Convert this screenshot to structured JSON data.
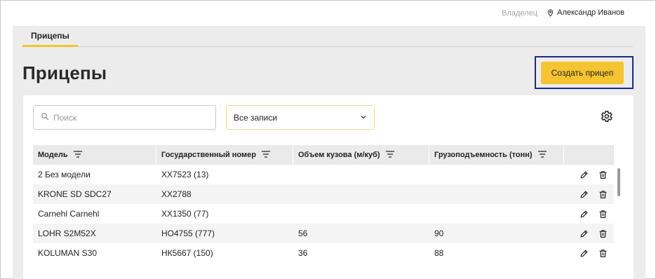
{
  "header": {
    "role_label": "Владелец",
    "user_name": "Александр Иванов"
  },
  "tabs": [
    {
      "label": "Прицепы",
      "active": true
    }
  ],
  "page": {
    "title": "Прицепы",
    "create_button": "Создать прицеп"
  },
  "filters": {
    "search_placeholder": "Поиск",
    "records_select": "Все записи"
  },
  "table": {
    "columns": [
      "Модель",
      "Государственный номер",
      "Объем кузова (м/куб)",
      "Грузоподъемность (тонн)"
    ],
    "rows": [
      {
        "model": "2 Без модели",
        "plate": "ХХ7523 (13)",
        "volume": "",
        "capacity": ""
      },
      {
        "model": "KRONE SD SDC27",
        "plate": "ХХ2788",
        "volume": "",
        "capacity": ""
      },
      {
        "model": "Carnehl Carnehl",
        "plate": "ХХ1350 (77)",
        "volume": "",
        "capacity": ""
      },
      {
        "model": "LOHR S2M52X",
        "plate": "НО4755 (777)",
        "volume": "56",
        "capacity": "90"
      },
      {
        "model": "KOLUMAN S30",
        "plate": "НК5667 (150)",
        "volume": "36",
        "capacity": "88"
      }
    ]
  },
  "colors": {
    "accent": "#f5c430",
    "highlight_border": "#1a2a8c",
    "workspace_bg": "#ececec"
  },
  "icons": {
    "user": "location-pin-icon",
    "search": "search-icon",
    "dropdown": "chevron-down-icon",
    "settings": "gear-icon",
    "sort": "filter-lines-icon",
    "edit": "pencil-icon",
    "delete": "trash-icon"
  }
}
